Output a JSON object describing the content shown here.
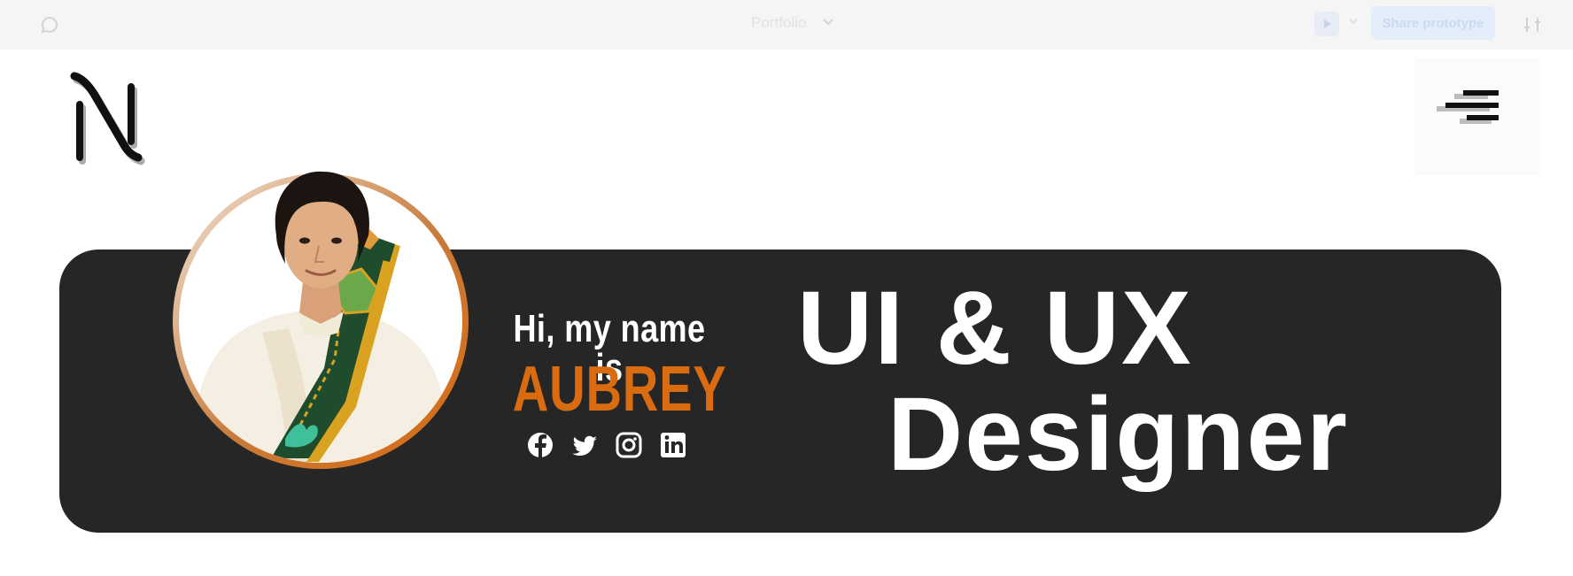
{
  "toolbar": {
    "file_title": "Portfolio",
    "share_label": "Share prototype",
    "icons": [
      "comment-icon",
      "chevron-down-icon",
      "play-icon",
      "settings-icon"
    ]
  },
  "site": {
    "logo_icon": "n-monogram-logo",
    "menu_icon": "hamburger-menu-icon"
  },
  "hero": {
    "greeting": "Hi, my name is",
    "name": "AUBREY",
    "headline_line1": "UI & UX",
    "headline_line2": "Designer",
    "social": [
      "facebook-icon",
      "twitter-icon",
      "instagram-icon",
      "linkedin-icon"
    ]
  },
  "colors": {
    "hero_bg": "#262626",
    "accent_orange": "#d96b10",
    "text_white": "#ffffff"
  }
}
